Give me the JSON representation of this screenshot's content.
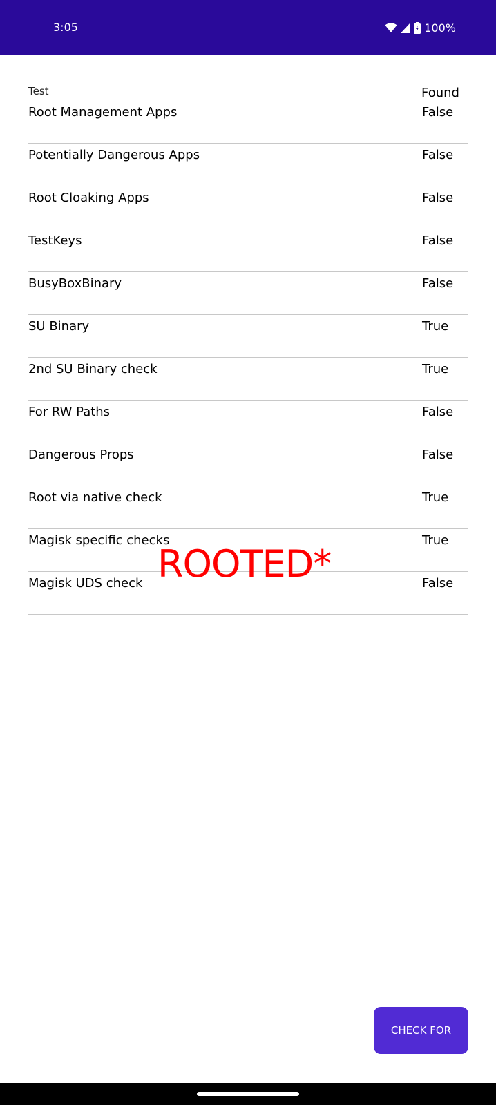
{
  "status_bar": {
    "time": "3:05",
    "battery": "100%",
    "background_color": "#2a0a9a",
    "icons": [
      "wifi-icon",
      "cellular-signal-icon",
      "battery-icon"
    ]
  },
  "table": {
    "header_test": "Test",
    "header_found": "Found",
    "rows": [
      {
        "name": "Root Management Apps",
        "found": "False"
      },
      {
        "name": "Potentially Dangerous Apps",
        "found": "False"
      },
      {
        "name": "Root Cloaking Apps",
        "found": "False"
      },
      {
        "name": "TestKeys",
        "found": "False"
      },
      {
        "name": "BusyBoxBinary",
        "found": "False"
      },
      {
        "name": "SU Binary",
        "found": "True"
      },
      {
        "name": "2nd SU Binary check",
        "found": "True"
      },
      {
        "name": "For RW Paths",
        "found": "False"
      },
      {
        "name": "Dangerous Props",
        "found": "False"
      },
      {
        "name": "Root via native check",
        "found": "True"
      },
      {
        "name": "Magisk specific checks",
        "found": "True"
      },
      {
        "name": "Magisk UDS check",
        "found": "False"
      }
    ]
  },
  "verdict": {
    "text": "ROOTED*",
    "color": "#ff0000"
  },
  "action": {
    "check_label": "CHECK FOR",
    "button_color": "#512bd4"
  }
}
